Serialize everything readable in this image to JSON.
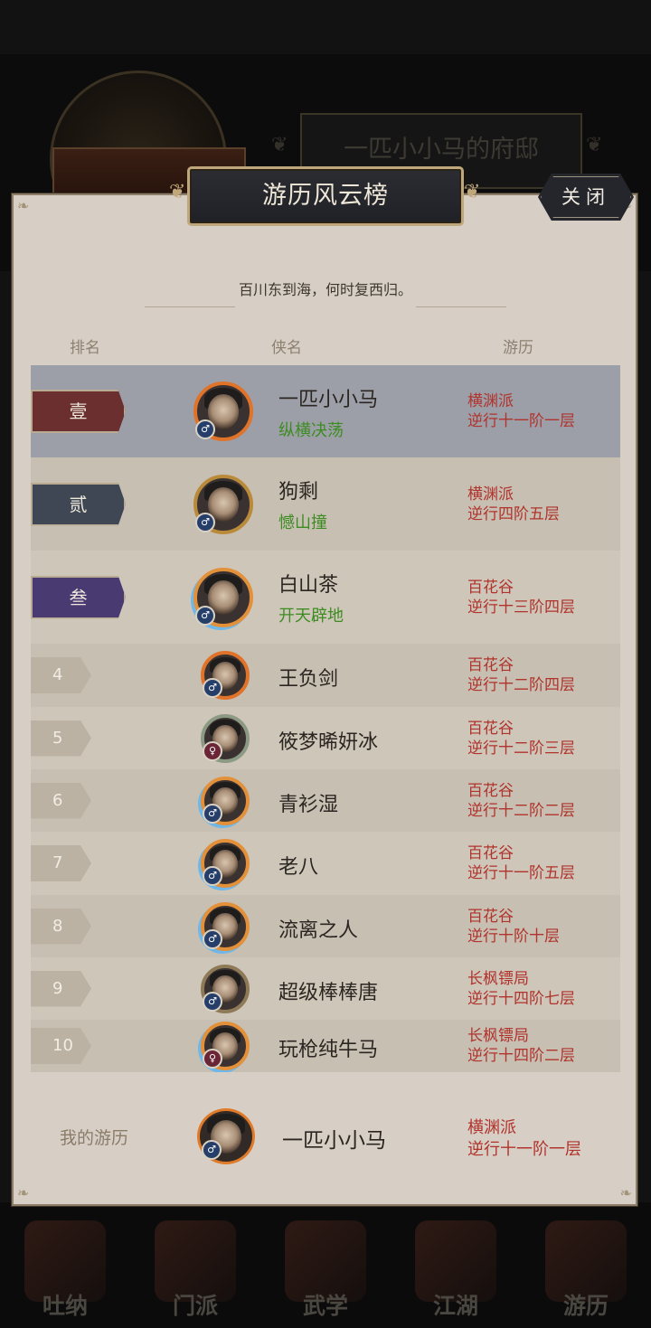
{
  "background": {
    "mansion_label": "一匹小小马的府邸",
    "nav": [
      {
        "label": "吐纳",
        "icon": "meditation-icon"
      },
      {
        "label": "门派",
        "icon": "sect-icon"
      },
      {
        "label": "武学",
        "icon": "martial-arts-icon"
      },
      {
        "label": "江湖",
        "icon": "jianghu-icon"
      },
      {
        "label": "游历",
        "icon": "travel-icon"
      }
    ]
  },
  "modal": {
    "title": "游历风云榜",
    "close_label": "关闭",
    "subtitle": "百川东到海，何时复西归。",
    "columns": {
      "rank": "排名",
      "name": "侠名",
      "travel": "游历"
    }
  },
  "rows": [
    {
      "rank": "壹",
      "name": "一匹小小马",
      "skill": "纵横决荡",
      "sect": "横渊派",
      "level": "逆行十一阶一层",
      "gender": "♂",
      "frame": "flame",
      "highlight": true
    },
    {
      "rank": "贰",
      "name": "狗剩",
      "skill": "憾山撞",
      "sect": "横渊派",
      "level": "逆行四阶五层",
      "gender": "♂",
      "frame": "gold-dragon",
      "highlight": false
    },
    {
      "rank": "叁",
      "name": "白山茶",
      "skill": "开天辟地",
      "sect": "百花谷",
      "level": "逆行十三阶四层",
      "gender": "♂",
      "frame": "flame-ice",
      "highlight": false
    },
    {
      "rank": "4",
      "name": "王负剑",
      "skill": "",
      "sect": "百花谷",
      "level": "逆行十二阶四层",
      "gender": "♂",
      "frame": "flame",
      "highlight": false
    },
    {
      "rank": "5",
      "name": "筱梦晞妍冰",
      "skill": "",
      "sect": "百花谷",
      "level": "逆行十二阶三层",
      "gender": "♀",
      "frame": "leaf",
      "highlight": false
    },
    {
      "rank": "6",
      "name": "青衫湿",
      "skill": "",
      "sect": "百花谷",
      "level": "逆行十二阶二层",
      "gender": "♂",
      "frame": "flame-ice",
      "highlight": false
    },
    {
      "rank": "7",
      "name": "老八",
      "skill": "",
      "sect": "百花谷",
      "level": "逆行十一阶五层",
      "gender": "♂",
      "frame": "flame-ice",
      "highlight": false
    },
    {
      "rank": "8",
      "name": "流离之人",
      "skill": "",
      "sect": "百花谷",
      "level": "逆行十阶十层",
      "gender": "♂",
      "frame": "flame-ice",
      "highlight": false
    },
    {
      "rank": "9",
      "name": "超级棒棒唐",
      "skill": "",
      "sect": "长枫镖局",
      "level": "逆行十四阶七层",
      "gender": "♂",
      "frame": "bronze",
      "highlight": false
    },
    {
      "rank": "10",
      "name": "玩枪纯牛马",
      "skill": "",
      "sect": "长枫镖局",
      "level": "逆行十四阶二层",
      "gender": "♀",
      "frame": "flame-ice",
      "highlight": false
    }
  ],
  "my_record": {
    "label": "我的游历",
    "name": "一匹小小马",
    "sect": "横渊派",
    "level": "逆行十一阶一层",
    "gender": "♂"
  },
  "colors": {
    "panel": "#d7cfc5",
    "row_alt": "#c8bfb3",
    "row_highlight": "#9d9fa8",
    "rank1": "#6b2f2f",
    "rank2": "#3e4753",
    "rank3": "#4a3a72",
    "sect_text": "#b0332c",
    "skill_text": "#3d8c22"
  }
}
